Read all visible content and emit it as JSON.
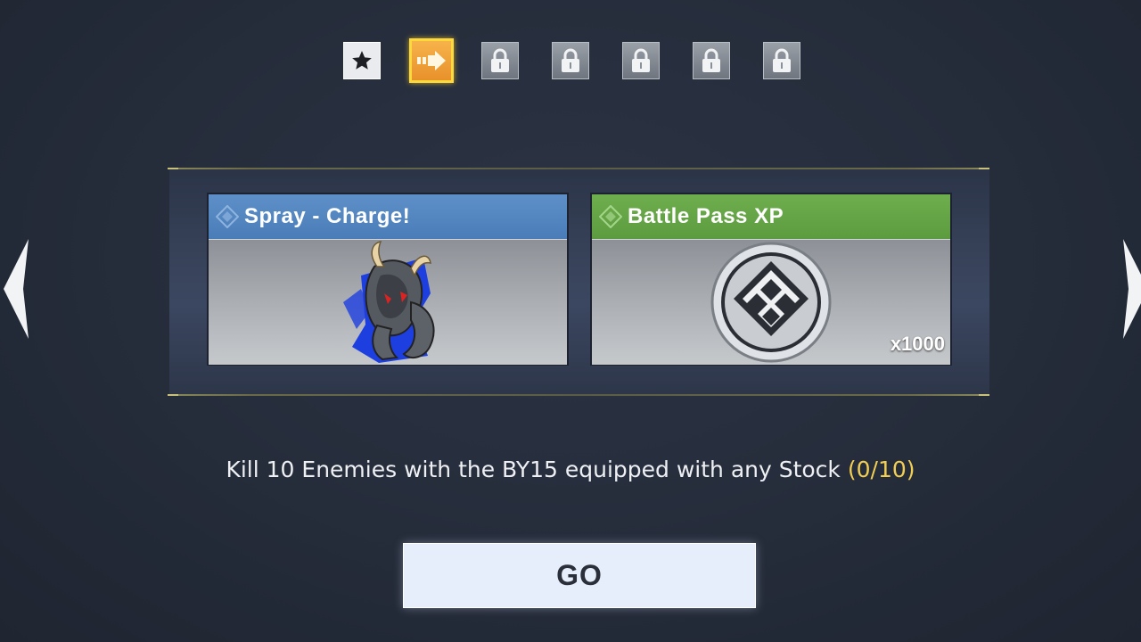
{
  "steps": [
    {
      "state": "completed",
      "icon": "star-icon"
    },
    {
      "state": "active",
      "icon": "arrow-right-icon"
    },
    {
      "state": "locked",
      "icon": "lock-icon"
    },
    {
      "state": "locked",
      "icon": "lock-icon"
    },
    {
      "state": "locked",
      "icon": "lock-icon"
    },
    {
      "state": "locked",
      "icon": "lock-icon"
    },
    {
      "state": "locked",
      "icon": "lock-icon"
    }
  ],
  "rewards": [
    {
      "title": "Spray - Charge!",
      "header_color": "#5585c0",
      "image": "ram-spray-image",
      "quantity": ""
    },
    {
      "title": "Battle Pass XP",
      "header_color": "#66a547",
      "image": "battle-pass-xp-emblem",
      "quantity": "x1000"
    }
  ],
  "mission": {
    "text": "Kill 10 Enemies with the BY15 equipped with any Stock",
    "progress": "(0/10)"
  },
  "go_button": {
    "label": "GO"
  },
  "nav": {
    "prev_icon": "chevron-left-icon",
    "next_icon": "chevron-right-icon"
  },
  "colors": {
    "active_step": "#f0a03a",
    "progress_text": "#f2cf52",
    "background": "#262d3b"
  }
}
